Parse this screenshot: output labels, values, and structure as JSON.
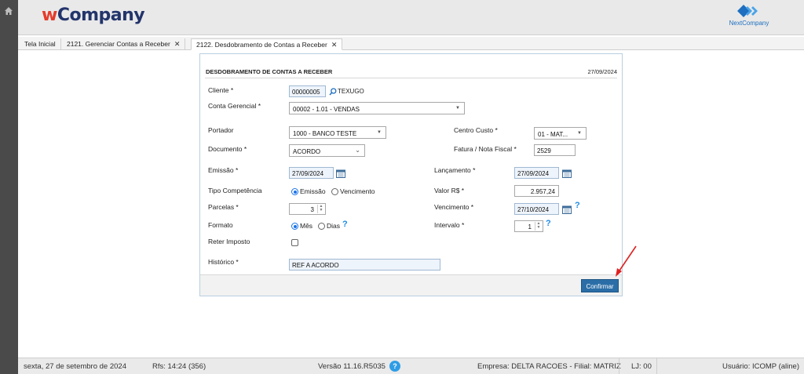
{
  "header": {
    "logo_w": "w",
    "logo_rest": "Company",
    "brand_right": "NextCompany"
  },
  "tabs": [
    {
      "label": "Tela Inicial"
    },
    {
      "label": "2121. Gerenciar Contas a Receber",
      "close": "✕"
    },
    {
      "label": "2122. Desdobramento de Contas a Receber",
      "close": "✕"
    }
  ],
  "form": {
    "title": "DESDOBRAMENTO DE CONTAS A RECEBER",
    "date": "27/09/2024",
    "cliente": {
      "label": "Cliente *",
      "code": "00000005",
      "name": "TEXUGO"
    },
    "conta_gerencial": {
      "label": "Conta Gerencial *",
      "value": "00002 - 1.01 - VENDAS"
    },
    "portador": {
      "label": "Portador",
      "value": "1000 - BANCO TESTE"
    },
    "centro_custo": {
      "label": "Centro Custo *",
      "value": "01 - MAT..."
    },
    "documento": {
      "label": "Documento *",
      "value": "ACORDO"
    },
    "fatura": {
      "label": "Fatura / Nota Fiscal *",
      "value": "2529"
    },
    "emissao": {
      "label": "Emissão *",
      "value": "27/09/2024"
    },
    "lancamento": {
      "label": "Lançamento *",
      "value": "27/09/2024"
    },
    "tipo_competencia": {
      "label": "Tipo Competência",
      "opt1": "Emissão",
      "opt2": "Vencimento",
      "selected": "Emissão"
    },
    "valor": {
      "label": "Valor R$ *",
      "value": "2.957,24"
    },
    "parcelas": {
      "label": "Parcelas *",
      "value": "3"
    },
    "vencimento": {
      "label": "Vencimento *",
      "value": "27/10/2024"
    },
    "formato": {
      "label": "Formato",
      "opt1": "Mês",
      "opt2": "Dias",
      "selected": "Mês"
    },
    "intervalo": {
      "label": "Intervalo *",
      "value": "1"
    },
    "reter_imposto": {
      "label": "Reter Imposto",
      "checked": false
    },
    "historico": {
      "label": "Histórico *",
      "value": "REF A ACORDO"
    },
    "confirm_label": "Confirmar"
  },
  "status": {
    "datetime": "sexta, 27 de setembro de 2024",
    "rfs": "Rfs: 14:24 (356)",
    "version": "Versão 11.16.R5035",
    "empresa": "Empresa: DELTA RACOES - Filial: MATRIZ",
    "lj": "LJ: 00",
    "usuario": "Usuário: ICOMP (aline)"
  },
  "colors": {
    "accent": "#2b6ea7",
    "brand_red": "#e53b2c",
    "brand_navy": "#22346b",
    "annotation_arrow": "#e02020"
  }
}
